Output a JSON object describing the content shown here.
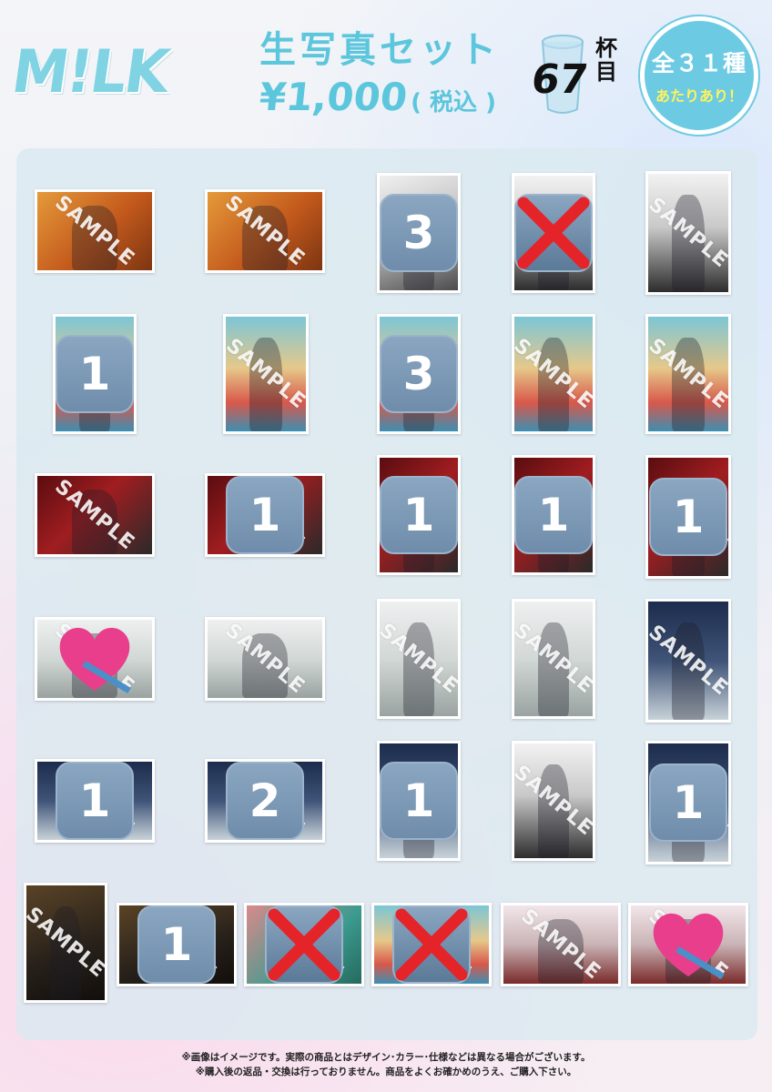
{
  "header": {
    "logo": "M!LK",
    "title": "生写真セット",
    "price": "¥1,000",
    "tax": "( 税込 )",
    "cup_count": "67",
    "cup_unit": "杯目",
    "badge_main": "全３１種",
    "badge_sub": "あたりあり！"
  },
  "watermark": "SAMPLE",
  "cards": [
    {
      "theme": "orange",
      "orient": "landscape",
      "status": "sample"
    },
    {
      "theme": "orange",
      "orient": "landscape",
      "status": "sample"
    },
    {
      "theme": "gray",
      "orient": "portrait",
      "status": "count",
      "count": "3"
    },
    {
      "theme": "bw",
      "orient": "portrait",
      "status": "crossed"
    },
    {
      "theme": "bw",
      "orient": "portrait",
      "status": "sample"
    },
    {
      "theme": "circus",
      "orient": "portrait",
      "status": "count",
      "count": "1"
    },
    {
      "theme": "circus",
      "orient": "portrait",
      "status": "sample"
    },
    {
      "theme": "circus",
      "orient": "portrait",
      "status": "count",
      "count": "3"
    },
    {
      "theme": "circus",
      "orient": "portrait",
      "status": "sample"
    },
    {
      "theme": "circus",
      "orient": "portrait",
      "status": "sample"
    },
    {
      "theme": "red",
      "orient": "landscape",
      "status": "sample"
    },
    {
      "theme": "red",
      "orient": "landscape",
      "status": "count",
      "count": "1"
    },
    {
      "theme": "red",
      "orient": "portrait",
      "status": "count",
      "count": "1"
    },
    {
      "theme": "red",
      "orient": "portrait",
      "status": "count",
      "count": "1"
    },
    {
      "theme": "red",
      "orient": "portrait",
      "status": "count",
      "count": "1"
    },
    {
      "theme": "white",
      "orient": "landscape",
      "status": "favorite"
    },
    {
      "theme": "white",
      "orient": "landscape",
      "status": "sample"
    },
    {
      "theme": "white",
      "orient": "portrait",
      "status": "sample"
    },
    {
      "theme": "white",
      "orient": "portrait",
      "status": "sample"
    },
    {
      "theme": "night",
      "orient": "portrait",
      "status": "sample"
    },
    {
      "theme": "night",
      "orient": "landscape",
      "status": "count",
      "count": "1"
    },
    {
      "theme": "night",
      "orient": "landscape",
      "status": "count",
      "count": "2"
    },
    {
      "theme": "night",
      "orient": "portrait",
      "status": "count",
      "count": "1"
    },
    {
      "theme": "bw",
      "orient": "portrait",
      "status": "sample"
    },
    {
      "theme": "night",
      "orient": "portrait",
      "status": "count",
      "count": "1"
    },
    {
      "theme": "dark",
      "orient": "portrait",
      "status": "sample"
    },
    {
      "theme": "dark",
      "orient": "landscape",
      "status": "count",
      "count": "1"
    },
    {
      "theme": "pink",
      "orient": "landscape",
      "status": "crossed"
    },
    {
      "theme": "circus",
      "orient": "landscape",
      "status": "crossed"
    },
    {
      "theme": "party",
      "orient": "landscape",
      "status": "sample"
    },
    {
      "theme": "party",
      "orient": "landscape",
      "status": "favorite"
    }
  ],
  "footer": {
    "note1": "※画像はイメージです。実際の商品とはデザイン･カラー･仕様などは異なる場合がございます。",
    "note2": "※購入後の返品・交換は行っておりません。商品をよくお確かめのうえ、ご購入下さい。"
  },
  "colors": {
    "accent": "#5cc6dc",
    "badge": "#6ccbe3",
    "badge_sub": "#fff35a",
    "cover": "#6f8dab",
    "cross": "#e5242a",
    "heart": "#e83e8c"
  }
}
